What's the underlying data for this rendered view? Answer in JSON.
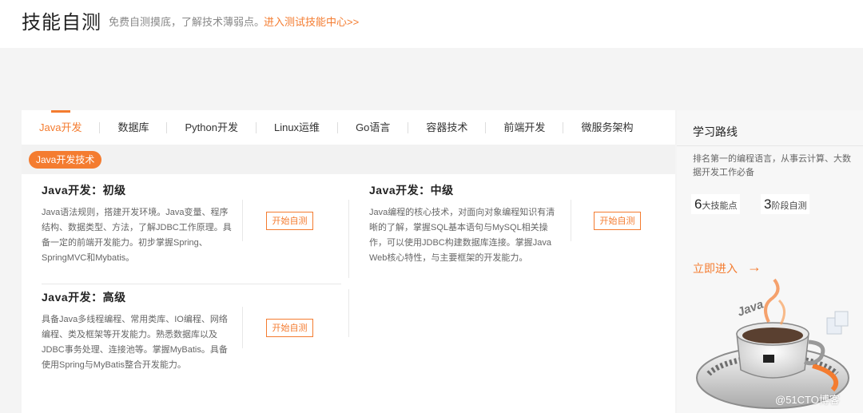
{
  "header": {
    "title": "技能自测",
    "subtitle": "免费自测摸底，了解技术薄弱点。",
    "link": "进入测试技能中心>>"
  },
  "tabs": [
    {
      "label": "Java开发",
      "active": true
    },
    {
      "label": "数据库",
      "active": false
    },
    {
      "label": "Python开发",
      "active": false
    },
    {
      "label": "Linux运维",
      "active": false
    },
    {
      "label": "Go语言",
      "active": false
    },
    {
      "label": "容器技术",
      "active": false
    },
    {
      "label": "前端开发",
      "active": false
    },
    {
      "label": "微服务架构",
      "active": false
    }
  ],
  "category_pill": "Java开发技术",
  "courses": [
    {
      "title": "Java开发：初级",
      "desc_lines": [
        "Java语法规则，搭建开发环境。Java变量、程序",
        "结构、数据类型、方法，了解JDBC工作原理。具",
        "备一定的前端开发能力。初步掌握Spring、",
        "SpringMVC和Mybatis。"
      ],
      "button": "开始自测"
    },
    {
      "title": "Java开发：中级",
      "desc_lines": [
        "Java编程的核心技术，对面向对象编程知识有清",
        "晰的了解，掌握SQL基本语句与MySQL相关操",
        "作，可以使用JDBC构建数据库连接。掌握Java",
        "Web核心特性，与主要框架的开发能力。"
      ],
      "button": "开始自测"
    },
    {
      "title": "Java开发：高级",
      "desc_lines": [
        "具备Java多线程编程、常用类库、IO编程、网络",
        "编程、类及框架等开发能力。熟悉数据库以及",
        "JDBC事务处理、连接池等。掌握MyBatis。具备",
        "使用Spring与MyBatis整合开发能力。"
      ],
      "button": "开始自测"
    }
  ],
  "sidebar": {
    "title": "学习路线",
    "desc": "排名第一的编程语言，从事云计算、大数据开发工作必备",
    "stats": [
      {
        "num": "6",
        "label": "大技能点"
      },
      {
        "num": "3",
        "label": "阶段自测"
      }
    ],
    "enter_label": "立即进入",
    "enter_arrow": "→",
    "cup_text": "Java"
  },
  "watermark": "@51CTO博客",
  "colors": {
    "accent": "#f47c30",
    "background": "#f4f4f4"
  }
}
